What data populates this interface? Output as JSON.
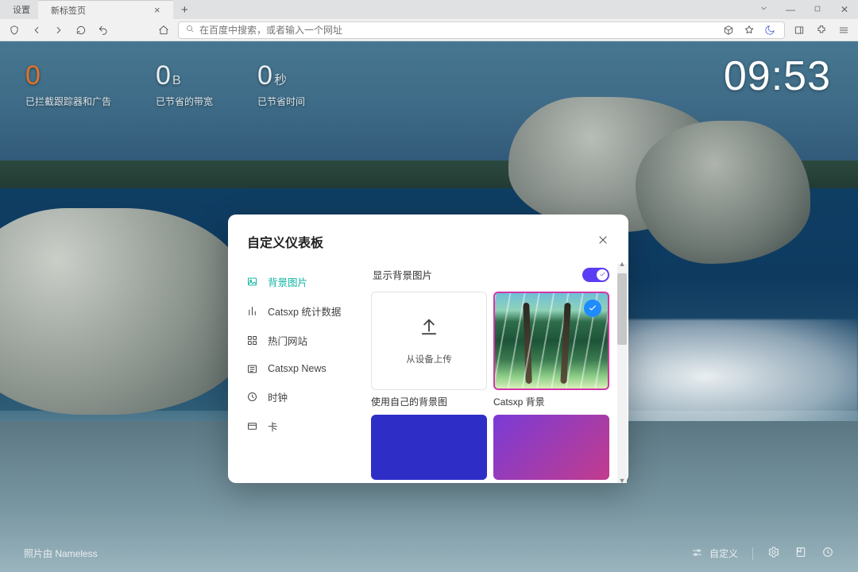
{
  "tabs": {
    "settings": "设置",
    "newtab": "新标签页"
  },
  "addr": {
    "placeholder": "在百度中搜索，或者输入一个网址"
  },
  "stats": [
    {
      "num": "0",
      "unit": "",
      "label": "已拦截跟踪器和广告"
    },
    {
      "num": "0",
      "unit": "B",
      "label": "已节省的带宽"
    },
    {
      "num": "0",
      "unit": "秒",
      "label": "已节省时间"
    }
  ],
  "clock": "09:53",
  "footer": {
    "credit": "照片由 Nameless",
    "customize": "自定义"
  },
  "modal": {
    "title": "自定义仪表板",
    "sidebar": [
      {
        "icon": "image",
        "label": "背景图片"
      },
      {
        "icon": "barchart",
        "label": "Catsxp 统计数据"
      },
      {
        "icon": "grid",
        "label": "热门网站"
      },
      {
        "icon": "news",
        "label": "Catsxp News"
      },
      {
        "icon": "clock",
        "label": "时钟"
      },
      {
        "icon": "card",
        "label": "卡"
      }
    ],
    "show_bg_label": "显示背景图片",
    "upload_label": "从设备上传",
    "option_a_label": "使用自己的背景图",
    "option_b_label": "Catsxp 背景"
  }
}
